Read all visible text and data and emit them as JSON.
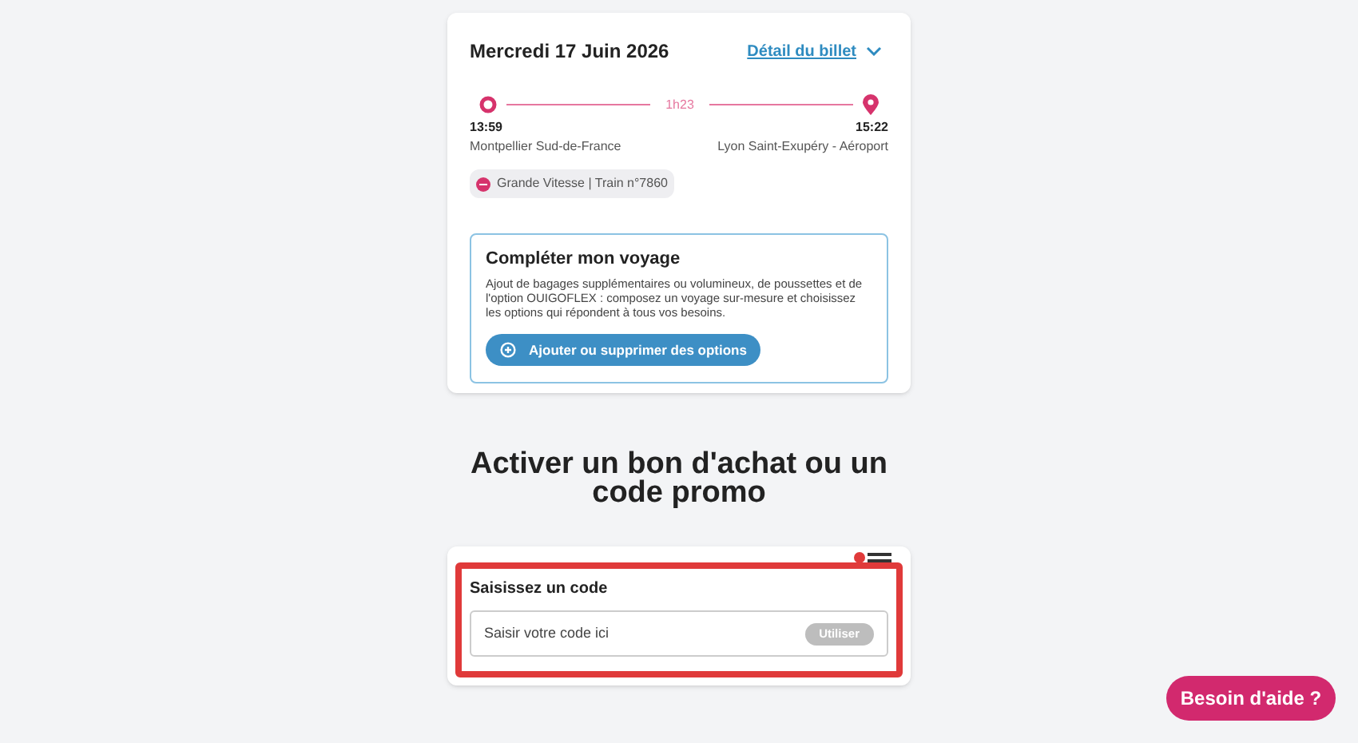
{
  "trip": {
    "date": "Mercredi 17 Juin 2026",
    "detail_link": "Détail du billet",
    "duration": "1h23",
    "departure": {
      "time": "13:59",
      "station": "Montpellier Sud-de-France"
    },
    "arrival": {
      "time": "15:22",
      "station": "Lyon Saint-Exupéry - Aéroport"
    },
    "train": "Grande Vitesse | Train n°7860"
  },
  "options": {
    "title": "Compléter mon voyage",
    "text": "Ajout de bagages supplémentaires ou volumineux, de poussettes et de l'option OUIGOFLEX : composez un voyage sur-mesure et choisissez les options qui répondent à tous vos besoins.",
    "button": "Ajouter ou supprimer des options"
  },
  "promo": {
    "heading": "Activer un bon d'achat ou un code promo",
    "label": "Saisissez un code",
    "placeholder": "Saisir votre code ici",
    "button": "Utiliser",
    "button_disabled": true,
    "highlighted": true
  },
  "help_button": "Besoin d'aide ?"
}
